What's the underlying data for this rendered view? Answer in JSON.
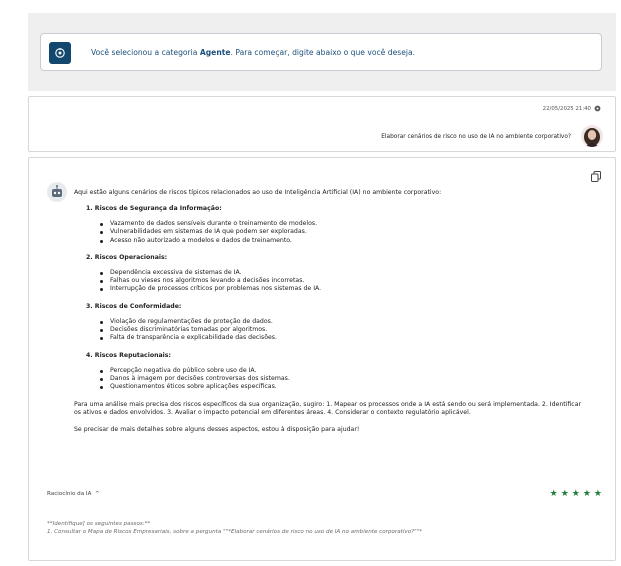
{
  "intro": {
    "prefix": "Você selecionou a categoria ",
    "category": "Agente",
    "suffix": ". Para começar, digite abaixo o que você deseja."
  },
  "user_message": {
    "timestamp": "22/05/2025 21:40",
    "text": "Elaborar cenários de risco no uso de IA no ambiente corporativo?"
  },
  "answer": {
    "intro": "Aqui estão alguns cenários de riscos típicos relacionados ao uso de Inteligência Artificial (IA) no ambiente corporativo:",
    "sections": [
      {
        "title": "1. Riscos de Segurança da Informação:",
        "items": [
          "Vazamento de dados sensíveis durante o treinamento de modelos.",
          "Vulnerabilidades em sistemas de IA que podem ser exploradas.",
          "Acesso não autorizado a modelos e dados de treinamento."
        ]
      },
      {
        "title": "2. Riscos Operacionais:",
        "items": [
          "Dependência excessiva de sistemas de IA.",
          "Falhas ou vieses nos algoritmos levando a decisões incorretas.",
          "Interrupção de processos críticos por problemas nos sistemas de IA."
        ]
      },
      {
        "title": "3. Riscos de Conformidade:",
        "items": [
          "Violação de regulamentações de proteção de dados.",
          "Decisões discriminatórias tomadas por algoritmos.",
          "Falta de transparência e explicabilidade das decisões."
        ]
      },
      {
        "title": "4. Riscos Reputacionais:",
        "items": [
          "Percepção negativa do público sobre uso de IA.",
          "Danos à imagem por decisões controversas dos sistemas.",
          "Questionamentos éticos sobre aplicações específicas."
        ]
      }
    ],
    "analysis": "Para uma análise mais precisa dos riscos específicos da sua organização, sugiro: 1. Mapear os processos onde a IA está sendo ou será implementada. 2. Identificar os ativos e dados envolvidos. 3. Avaliar o impacto potencial em diferentes áreas. 4. Considerar o contexto regulatório aplicável.",
    "closing": "Se precisar de mais detalhes sobre alguns desses aspectos, estou à disposição para ajudar!",
    "reasoning_label": "Raciocínio da IA",
    "rating": 5,
    "star_color": "#1e7f39",
    "footnote_line1": "**Identifique] os seguintes passos:**",
    "footnote_line2": "1. Consultar o Mapa de Riscos Empresariais, sobre a pergunta \"\"*Elaborar cenários de risco no uso de IA no ambiente corporativo?\"\"*"
  }
}
